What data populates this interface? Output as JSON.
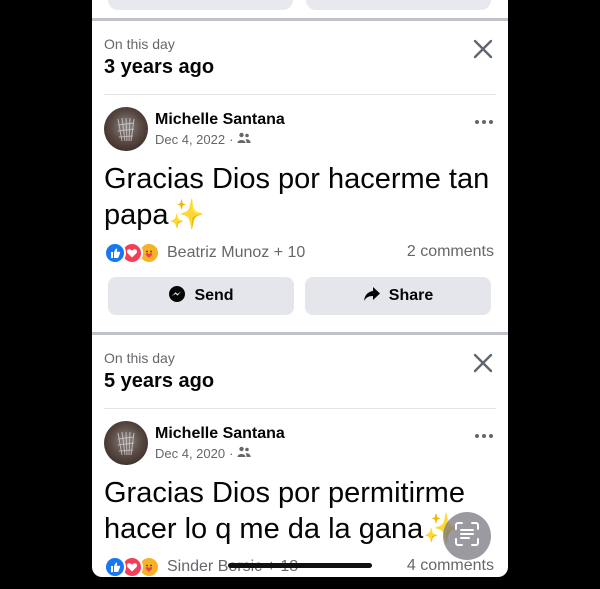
{
  "memories": [
    {
      "section_label": "On this day",
      "years_ago": "3 years ago",
      "author": "Michelle Santana",
      "date": "Dec 4, 2022",
      "meta_separator": "·",
      "audience_icon": "friends-icon",
      "text": "Gracias Dios por hacerme tan papa✨",
      "reactions_text": "Beatriz Munoz + 10",
      "comments": "2 comments",
      "send_label": "Send",
      "share_label": "Share"
    },
    {
      "section_label": "On this day",
      "years_ago": "5 years ago",
      "author": "Michelle Santana",
      "date": "Dec 4, 2020",
      "meta_separator": "·",
      "audience_icon": "friends-icon",
      "text": "Gracias Dios por permitirme hacer lo q me da la gana✨",
      "reactions_text": "Sinder Borsic + 18",
      "comments": "4 comments"
    }
  ],
  "colors": {
    "primary_text": "#050505",
    "secondary_text": "#65676b",
    "button_bg": "#e4e6eb",
    "like": "#1877f2",
    "love": "#f33e58",
    "care": "#f7b125"
  }
}
